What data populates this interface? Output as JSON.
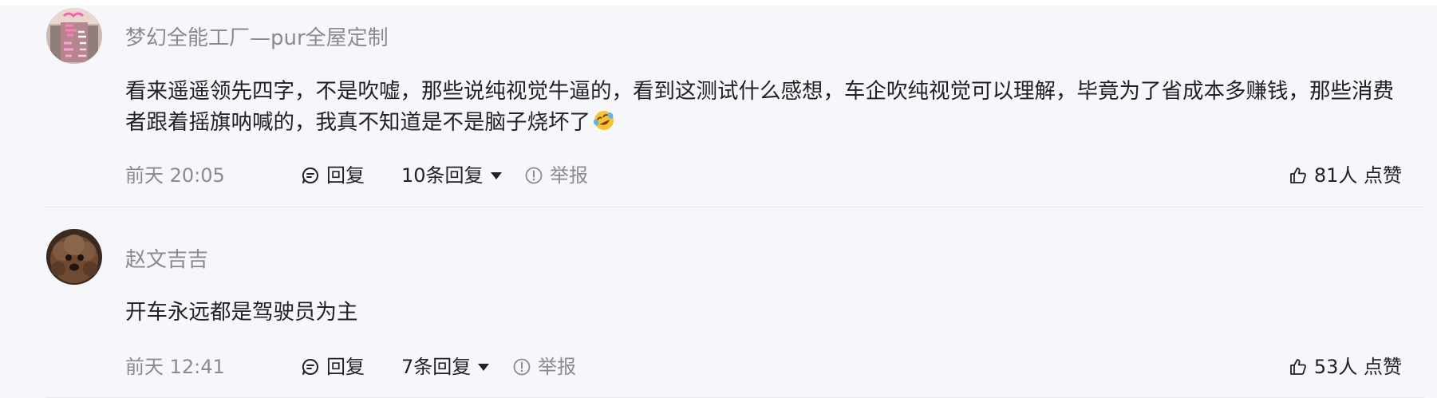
{
  "colors": {
    "panel_bg": "#f6f7fa",
    "username": "#8a8b91",
    "text": "#222226",
    "muted": "#8a8b91",
    "divider": "#e6e7eb"
  },
  "comments": [
    {
      "username": "梦幻全能工厂—pur全屋定制",
      "avatar_icon": "pink-neon-sign-avatar",
      "content": "看来遥遥领先四字，不是吹嘘，那些说纯视觉牛逼的，看到这测试什么感想，车企吹纯视觉可以理解，毕竟为了省成本多赚钱，那些消费者跟着摇旗呐喊的，我真不知道是不是脑子烧坏了",
      "content_emoji": "rolling-on-floor-laughing-emoji",
      "time": "前天 20:05",
      "reply_label": "回复",
      "replies_label": "10条回复",
      "report_label": "举报",
      "like_label": "81人 点赞"
    },
    {
      "username": "赵文吉吉",
      "avatar_icon": "dog-photo-avatar",
      "content": "开车永远都是驾驶员为主",
      "time": "前天 12:41",
      "reply_label": "回复",
      "replies_label": "7条回复",
      "report_label": "举报",
      "like_label": "53人 点赞"
    }
  ]
}
